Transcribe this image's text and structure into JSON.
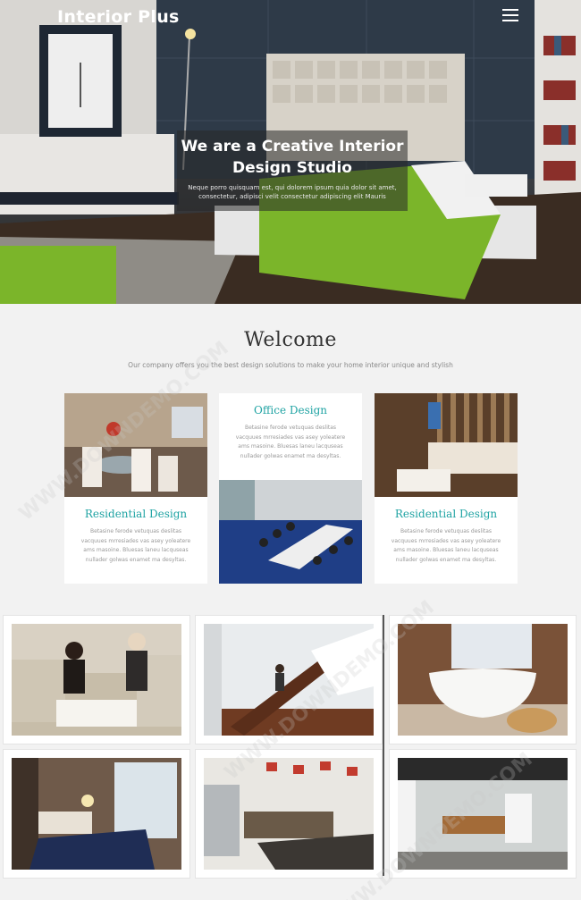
{
  "header": {
    "brand": "Interior Plus",
    "menu_icon": "hamburger-menu-icon"
  },
  "hero": {
    "title_line1": "We are a Creative Interior",
    "title_line2": "Design Studio",
    "text": "Neque porro quisquam est, qui dolorem ipsum quia dolor sit amet, consectetur, adipisci velit consectetur adipiscing elit Mauris"
  },
  "welcome": {
    "title": "Welcome",
    "subtitle": "Our company offers you the best design solutions to make your home interior unique and stylish"
  },
  "cards": [
    {
      "title": "Residential Design",
      "text": "Betasine ferode vetuquas deslitas vacquues mrresiades vas asey yoleatere ams masoine. Bluesas laneu lacquseas nullader golwas enamet ma desyltas."
    },
    {
      "title": "Office Design",
      "text": "Betasine ferode vetuquas deslitas vacquues mrresiades vas asey yoleatere ams masoine. Bluesas laneu lacquseas nullader golwas enamet ma desyltas."
    },
    {
      "title": "Residential Design",
      "text": "Betasine ferode vetuquas deslitas vacquues mrresiades vas asey yoleatere ams masoine. Bluesas laneu lacquseas nullader golwas enamet ma desyltas."
    }
  ],
  "gallery": [
    {
      "subject": "living-room-photo"
    },
    {
      "subject": "staircase-photo"
    },
    {
      "subject": "bathtub-photo"
    },
    {
      "subject": "bedroom-photo"
    },
    {
      "subject": "kitchen-photo"
    },
    {
      "subject": "office-hall-photo"
    }
  ],
  "watermark": "WWW.DOWNDEMO.COM",
  "colors": {
    "accent": "#1fa3a3",
    "hero_overlay": "#282828",
    "bed_green": "#7bb52a"
  }
}
